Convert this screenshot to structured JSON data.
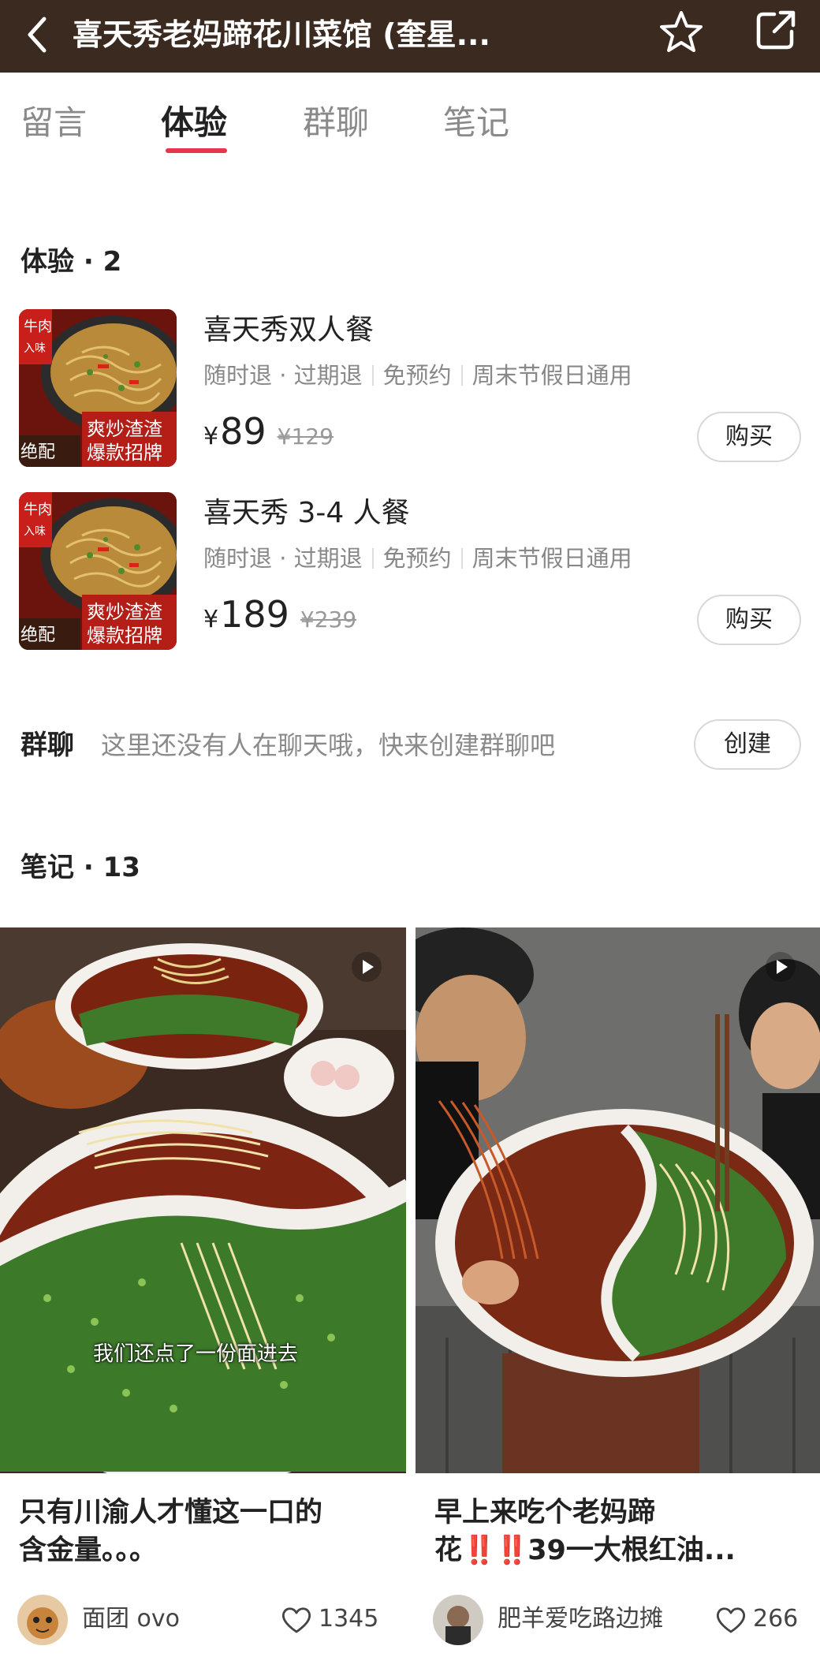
{
  "header": {
    "title": "喜天秀老妈蹄花川菜馆 (奎星...",
    "back_icon": "chevron-left-icon",
    "favorite_icon": "star-icon",
    "share_icon": "share-icon",
    "bg_color": "#3b2a20"
  },
  "tabs": [
    {
      "label": "留言",
      "active": false
    },
    {
      "label": "体验",
      "active": true
    },
    {
      "label": "群聊",
      "active": false
    },
    {
      "label": "笔记",
      "active": false
    }
  ],
  "experience": {
    "section_title": "体验 · 2",
    "items": [
      {
        "name": "喜天秀双人餐",
        "tags": [
          "随时退 · 过期退",
          "免预约",
          "周末节假日通用"
        ],
        "currency": "¥",
        "price": "89",
        "original_price": "¥129",
        "button": "购买"
      },
      {
        "name": "喜天秀 3-4 人餐",
        "tags": [
          "随时退 · 过期退",
          "免预约",
          "周末节假日通用"
        ],
        "currency": "¥",
        "price": "189",
        "original_price": "¥239",
        "button": "购买"
      }
    ]
  },
  "group_chat": {
    "label": "群聊",
    "hint": "这里还没有人在聊天哦，快来创建群聊吧",
    "button": "创建"
  },
  "notes": {
    "section_title": "笔记 · 13",
    "items": [
      {
        "title_line1": "只有川渝人才懂这一口的",
        "title_line2": "含金量。。。",
        "caption": "我们还点了一份面进去",
        "author": "面团 ovo",
        "likes": "1345"
      },
      {
        "title_line1": "早上来吃个老妈蹄",
        "title_line2_prefix": "花",
        "title_line2_bangs": "‼️‼️",
        "title_line2_suffix": "39一大根红油...",
        "author": "肥羊爱吃路边摊",
        "likes": "266"
      }
    ]
  },
  "colors": {
    "accent": "#e8354a",
    "muted_text": "#8a8a8a"
  }
}
